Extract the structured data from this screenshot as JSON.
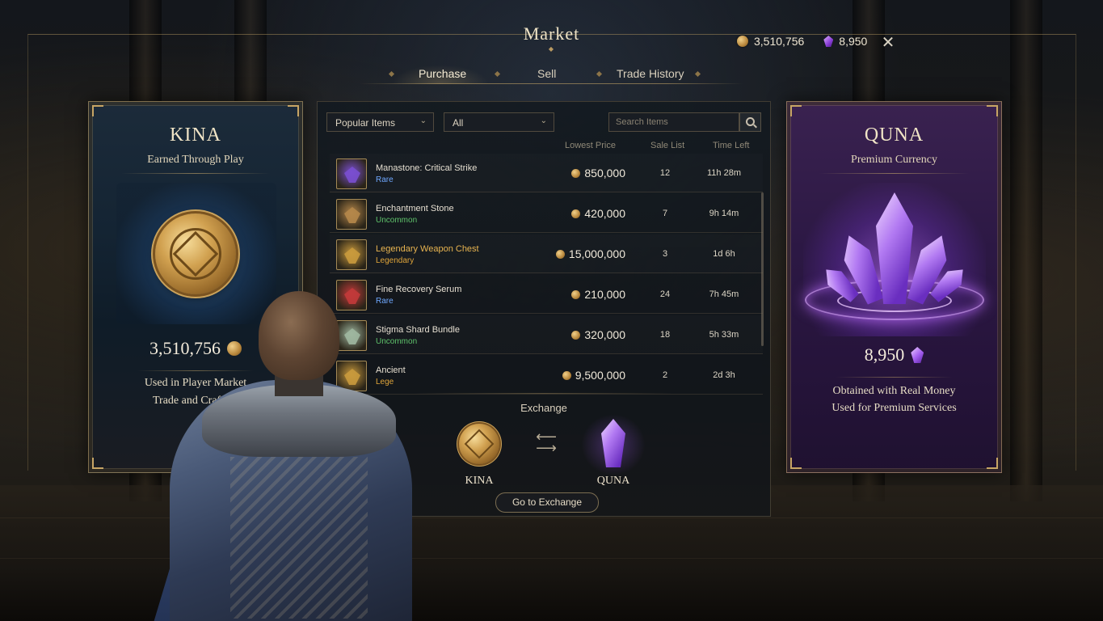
{
  "window": {
    "title": "Market",
    "close_icon": "close-icon"
  },
  "wallet": {
    "kina": "3,510,756",
    "quna": "8,950"
  },
  "tabs": [
    {
      "label": "Purchase",
      "active": true
    },
    {
      "label": "Sell",
      "active": false
    },
    {
      "label": "Trade History",
      "active": false
    }
  ],
  "kina_panel": {
    "title": "KINA",
    "subtitle": "Earned Through Play",
    "amount": "3,510,756",
    "desc_line1": "Used in Player Market",
    "desc_line2": "Trade and Crafting"
  },
  "quna_panel": {
    "title": "QUNA",
    "subtitle": "Premium Currency",
    "amount": "8,950",
    "desc_line1": "Obtained with Real Money",
    "desc_line2": "Used for Premium Services"
  },
  "filters": {
    "category": "Popular Items",
    "type": "All",
    "search_placeholder": "Search Items"
  },
  "table": {
    "headers": [
      "Lowest Price",
      "Sale List",
      "Time Left"
    ],
    "rows": [
      {
        "name": "Manastone: Critical Strike",
        "rarity": "Rare",
        "rarity_color": "#6fa8ff",
        "price": "850,000",
        "sale": "12",
        "time": "11h 28m",
        "icon": "manastone-icon",
        "icon_color": "#7a4fd0"
      },
      {
        "name": "Enchantment Stone",
        "rarity": "Uncommon",
        "rarity_color": "#5fc36b",
        "price": "420,000",
        "sale": "7",
        "time": "9h 14m",
        "icon": "enchantment-stone-icon",
        "icon_color": "#b5874a"
      },
      {
        "name": "Legendary Weapon Chest",
        "rarity": "Legendary",
        "rarity_color": "#e0a53a",
        "price": "15,000,000",
        "sale": "3",
        "time": "1d 6h",
        "icon": "treasure-chest-icon",
        "icon_color": "#c99a3d",
        "name_color": "#e8b450"
      },
      {
        "name": "Fine Recovery Serum",
        "rarity": "Rare",
        "rarity_color": "#6fa8ff",
        "price": "210,000",
        "sale": "24",
        "time": "7h 45m",
        "icon": "potion-icon",
        "icon_color": "#c23a3a"
      },
      {
        "name": "Stigma Shard Bundle",
        "rarity": "Uncommon",
        "rarity_color": "#5fc36b",
        "price": "320,000",
        "sale": "18",
        "time": "5h 33m",
        "icon": "stigma-shard-icon",
        "icon_color": "#9fb7a0"
      },
      {
        "name": "Ancient",
        "rarity": "Lege",
        "rarity_color": "#e0a53a",
        "price": "9,500,000",
        "sale": "2",
        "time": "2d 3h",
        "icon": "ancient-relic-icon",
        "icon_color": "#c99a3d"
      }
    ]
  },
  "exchange": {
    "title": "Exchange",
    "from": "KINA",
    "to": "QUNA",
    "button": "Go to Exchange"
  }
}
